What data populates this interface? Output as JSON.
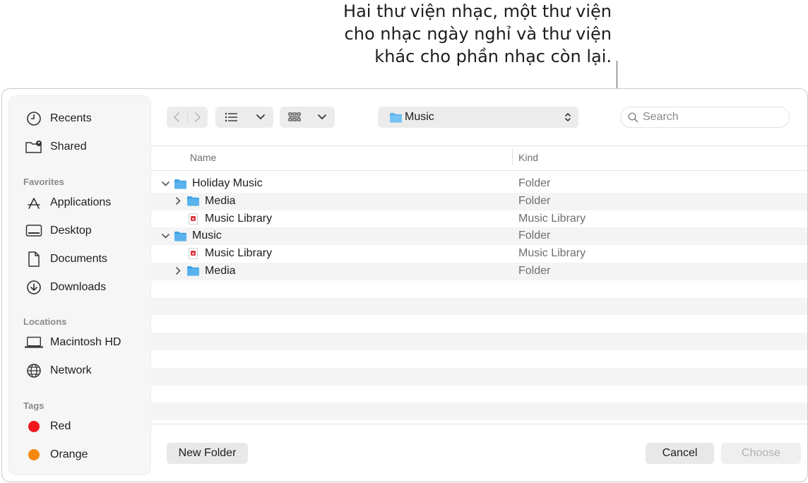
{
  "callout": {
    "line1": "Hai thư viện nhạc, một thư viện",
    "line2": "cho nhạc ngày nghỉ và thư viện",
    "line3": "khác cho phần nhạc còn lại."
  },
  "sidebar": {
    "top_items": [
      {
        "label": "Recents",
        "icon": "clock-icon"
      },
      {
        "label": "Shared",
        "icon": "shared-folder-icon"
      }
    ],
    "favorites_heading": "Favorites",
    "favorites": [
      {
        "label": "Applications",
        "icon": "applications-icon"
      },
      {
        "label": "Desktop",
        "icon": "desktop-icon"
      },
      {
        "label": "Documents",
        "icon": "document-icon"
      },
      {
        "label": "Downloads",
        "icon": "download-icon"
      }
    ],
    "locations_heading": "Locations",
    "locations": [
      {
        "label": "Macintosh HD",
        "icon": "laptop-icon"
      },
      {
        "label": "Network",
        "icon": "globe-icon"
      }
    ],
    "tags_heading": "Tags",
    "tags": [
      {
        "label": "Red",
        "color": "#f0171d"
      },
      {
        "label": "Orange",
        "color": "#f5880d"
      }
    ]
  },
  "toolbar": {
    "path_label": "Music",
    "search_placeholder": "Search"
  },
  "columns": {
    "name": "Name",
    "kind": "Kind"
  },
  "files": [
    {
      "name": "Holiday Music",
      "kind": "Folder",
      "type": "folder",
      "expanded": true,
      "level": 0
    },
    {
      "name": "Media",
      "kind": "Folder",
      "type": "folder",
      "expanded": false,
      "level": 1
    },
    {
      "name": "Music Library",
      "kind": "Music Library",
      "type": "library",
      "level": 1
    },
    {
      "name": "Music",
      "kind": "Folder",
      "type": "folder",
      "expanded": true,
      "level": 0
    },
    {
      "name": "Music Library",
      "kind": "Music Library",
      "type": "library",
      "level": 1
    },
    {
      "name": "Media",
      "kind": "Folder",
      "type": "folder",
      "expanded": false,
      "level": 1
    }
  ],
  "footer": {
    "new_folder": "New Folder",
    "cancel": "Cancel",
    "choose": "Choose"
  },
  "colors": {
    "folder_blue": "#5ab3ec",
    "accent_red": "#e0303a"
  }
}
